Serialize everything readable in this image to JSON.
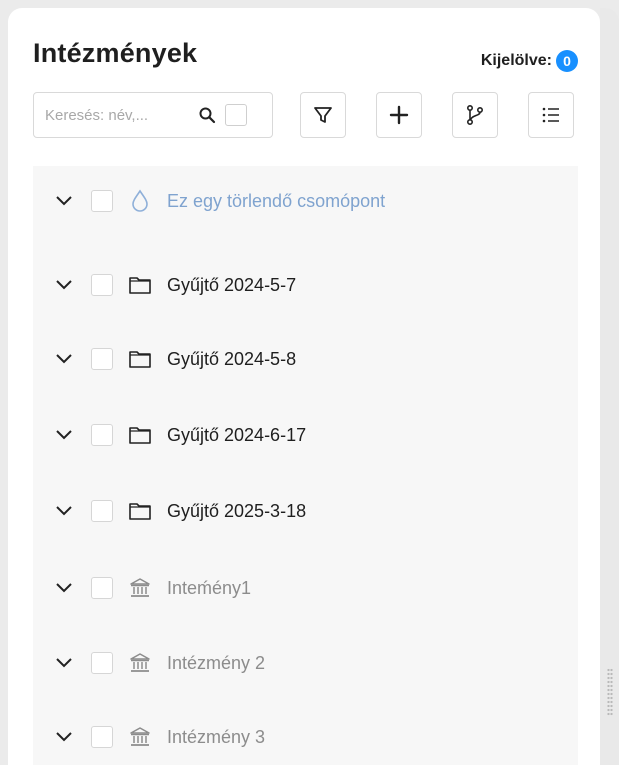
{
  "header": {
    "title": "Intézmények",
    "selected_label": "Kijelölve:",
    "selected_count": "0"
  },
  "search": {
    "placeholder": "Keresés: név,...",
    "value": ""
  },
  "toolbar": [
    {
      "name": "filter-button",
      "icon": "filter-icon"
    },
    {
      "name": "add-button",
      "icon": "plus-icon"
    },
    {
      "name": "branch-button",
      "icon": "git-branch-icon"
    },
    {
      "name": "list-button",
      "icon": "list-icon"
    }
  ],
  "tree": {
    "items": [
      {
        "label": "Ez egy törlendő csomópont",
        "icon": "drop-icon",
        "style": "deleted"
      },
      {
        "label": "Gyűjtő 2024-5-7",
        "icon": "folder-icon",
        "style": "normal"
      },
      {
        "label": "Gyűjtő 2024-5-8",
        "icon": "folder-icon",
        "style": "normal"
      },
      {
        "label": "Gyűjtő 2024-6-17",
        "icon": "folder-icon",
        "style": "normal"
      },
      {
        "label": "Gyűjtő 2025-3-18",
        "icon": "folder-icon",
        "style": "normal"
      },
      {
        "label": "Inteḿény1",
        "icon": "bank-icon",
        "style": "muted"
      },
      {
        "label": "Intézmény 2",
        "icon": "bank-icon",
        "style": "muted"
      },
      {
        "label": "Intézmény 3",
        "icon": "bank-icon",
        "style": "muted"
      }
    ]
  },
  "colors": {
    "accent": "#1890ff",
    "deleted_text": "#7fa3cf",
    "muted_text": "#8c8c8c"
  }
}
